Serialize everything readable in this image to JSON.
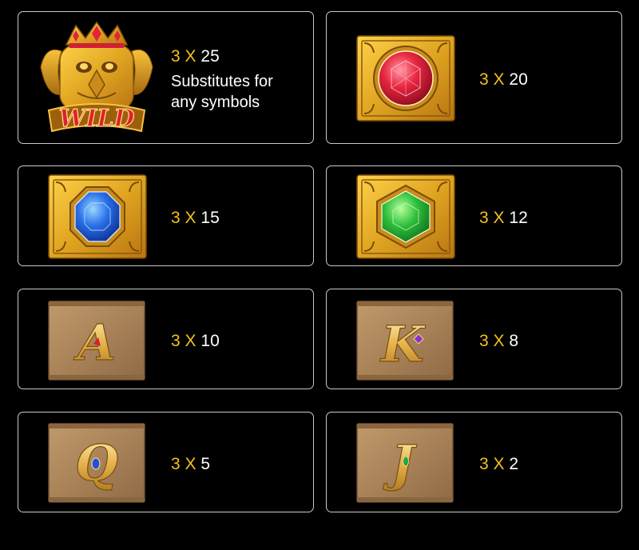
{
  "colors": {
    "background": "#000000",
    "card_border": "#c9c9c9",
    "multiplier_accent": "#f2c318",
    "text": "#ffffff",
    "gold_frame": "#e0a521",
    "stone_tile": "#b0885d"
  },
  "symbols": [
    {
      "icon": "wild-garuda-icon",
      "count": "3",
      "times": "X",
      "payout": "25",
      "description_line1": "Substitutes for",
      "description_line2": "any symbols",
      "icon_text": "WILD"
    },
    {
      "icon": "red-ruby-gem-icon",
      "count": "3",
      "times": "X",
      "payout": "20"
    },
    {
      "icon": "blue-sapphire-gem-icon",
      "count": "3",
      "times": "X",
      "payout": "15"
    },
    {
      "icon": "green-emerald-gem-icon",
      "count": "3",
      "times": "X",
      "payout": "12"
    },
    {
      "icon": "letter-a-icon",
      "count": "3",
      "times": "X",
      "payout": "10",
      "icon_text": "A"
    },
    {
      "icon": "letter-k-icon",
      "count": "3",
      "times": "X",
      "payout": "8",
      "icon_text": "K"
    },
    {
      "icon": "letter-q-icon",
      "count": "3",
      "times": "X",
      "payout": "5",
      "icon_text": "Q"
    },
    {
      "icon": "letter-j-icon",
      "count": "3",
      "times": "X",
      "payout": "2",
      "icon_text": "J"
    }
  ]
}
